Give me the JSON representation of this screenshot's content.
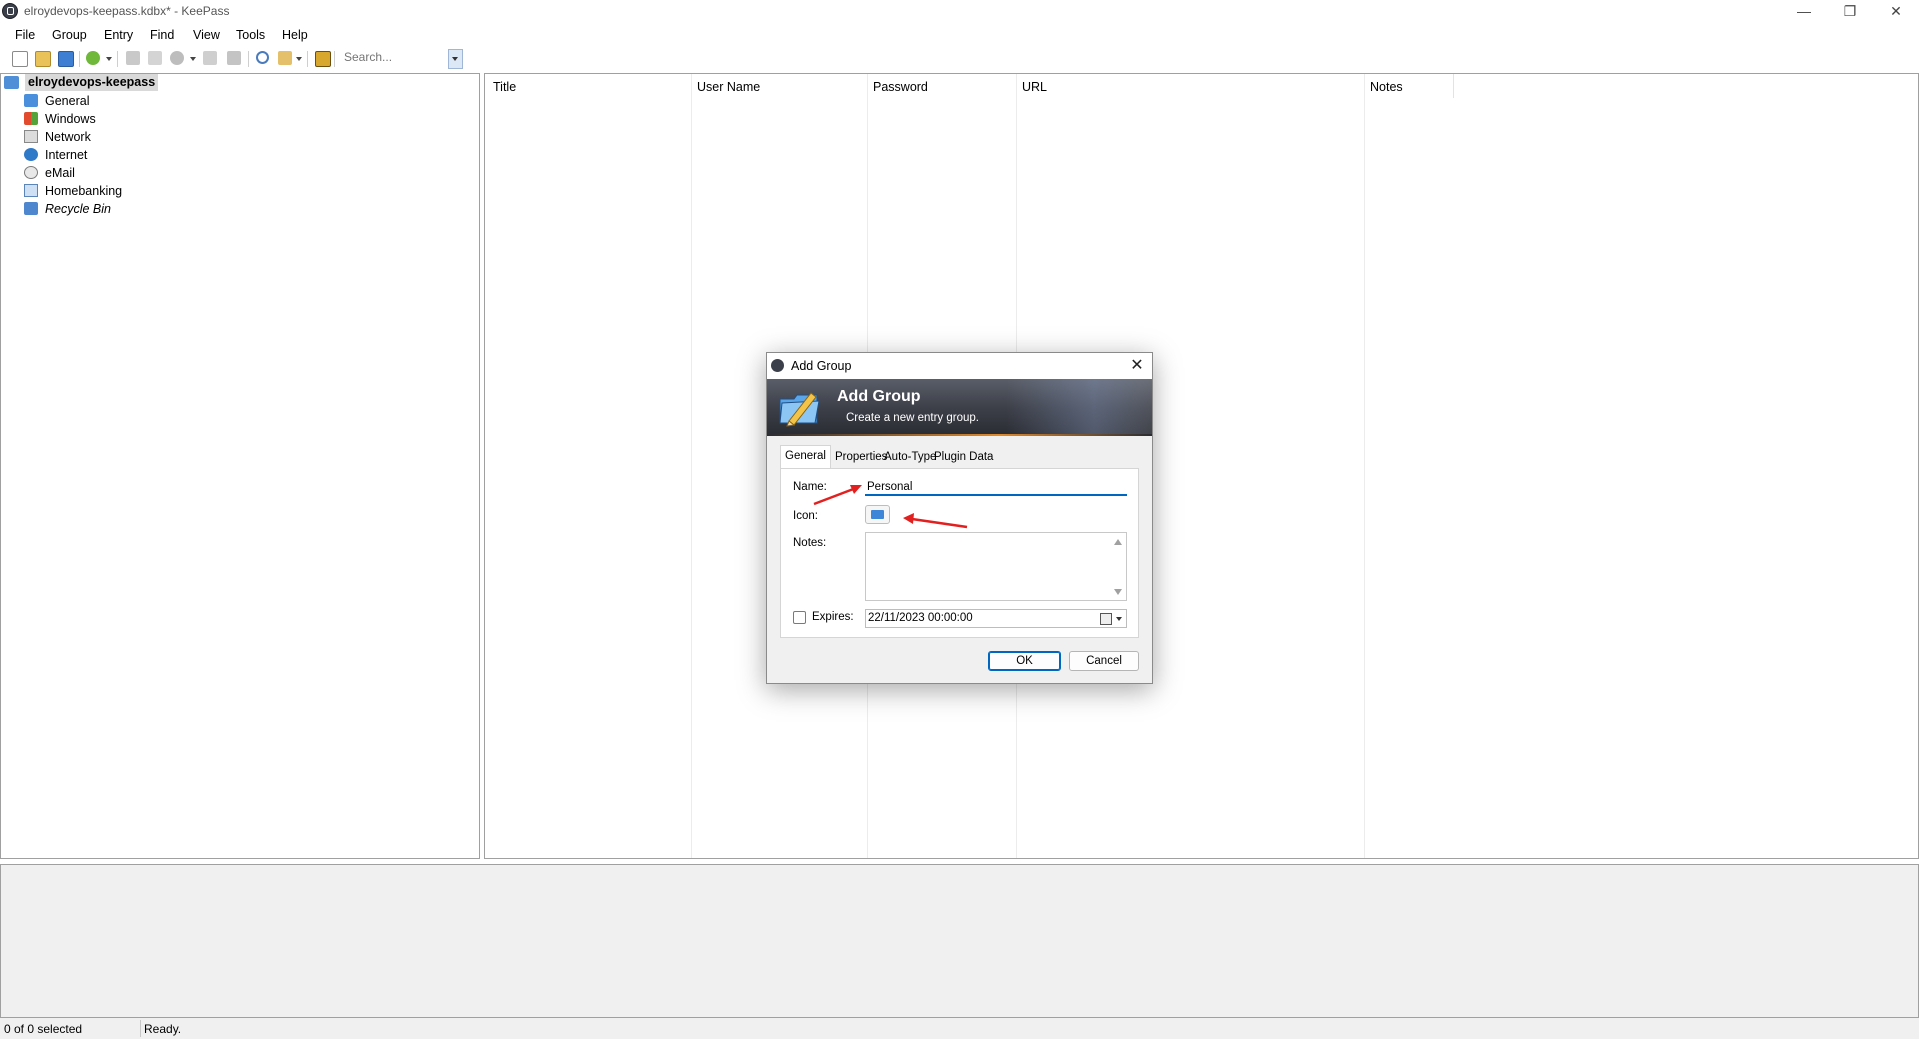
{
  "window": {
    "title": "elroydevops-keepass.kdbx* - KeePass",
    "controls": {
      "minimize": "—",
      "restore": "❐",
      "close": "✕"
    }
  },
  "menu": [
    "File",
    "Group",
    "Entry",
    "Find",
    "View",
    "Tools",
    "Help"
  ],
  "toolbar": {
    "search_placeholder": "Search...",
    "icons": [
      "new-database-icon",
      "open-database-icon",
      "save-icon",
      "add-entry-icon",
      "edit-entry-icon",
      "delete-entry-icon",
      "duplicate-entry-icon",
      "copy-username-icon",
      "copy-password-icon",
      "find-icon",
      "sync-icon",
      "lock-icon"
    ]
  },
  "tree": {
    "root": "elroydevops-keepass",
    "groups": [
      {
        "label": "General",
        "icon": "folder-icon"
      },
      {
        "label": "Windows",
        "icon": "windows-icon"
      },
      {
        "label": "Network",
        "icon": "network-icon"
      },
      {
        "label": "Internet",
        "icon": "globe-icon"
      },
      {
        "label": "eMail",
        "icon": "email-icon"
      },
      {
        "label": "Homebanking",
        "icon": "percent-icon"
      },
      {
        "label": "Recycle Bin",
        "icon": "recycle-bin-icon"
      }
    ]
  },
  "list": {
    "columns": [
      "Title",
      "User Name",
      "Password",
      "URL",
      "Notes"
    ]
  },
  "status": {
    "selection": "0 of 0 selected",
    "message": "Ready."
  },
  "dialog": {
    "title": "Add Group",
    "banner_title": "Add Group",
    "banner_subtitle": "Create a new entry group.",
    "tabs": [
      "General",
      "Properties",
      "Auto-Type",
      "Plugin Data"
    ],
    "active_tab": "General",
    "fields": {
      "name_label": "Name:",
      "name_value": "Personal",
      "icon_label": "Icon:",
      "notes_label": "Notes:",
      "notes_value": "",
      "expires_label": "Expires:",
      "expires_checked": false,
      "expires_value": "22/11/2023 00:00:00"
    },
    "buttons": {
      "ok": "OK",
      "cancel": "Cancel"
    }
  },
  "colors": {
    "annotation_arrow": "#e32020",
    "accent": "#0067c0",
    "banner_dark": "#2a2c33"
  }
}
